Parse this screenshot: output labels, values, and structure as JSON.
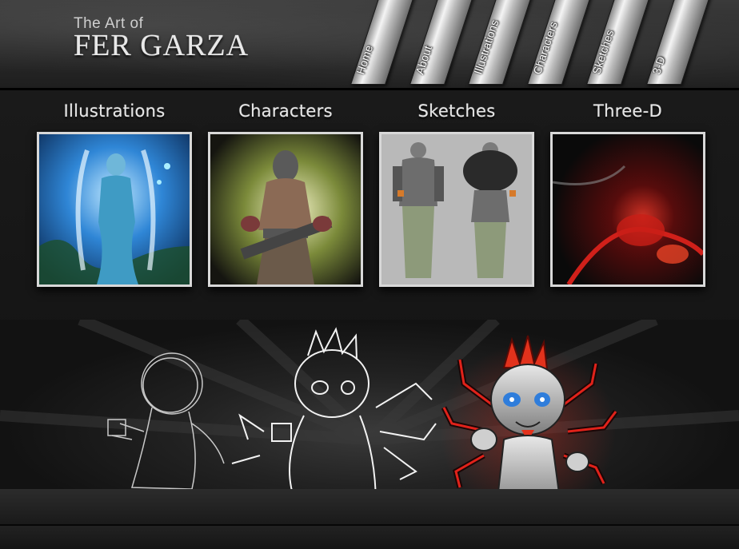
{
  "header": {
    "logo_sub": "The Art of",
    "logo_main": "FER GARZA"
  },
  "nav": {
    "items": [
      {
        "label": "Home"
      },
      {
        "label": "About"
      },
      {
        "label": "Illustrations"
      },
      {
        "label": "Characters"
      },
      {
        "label": "Sketches"
      },
      {
        "label": "3-D"
      }
    ]
  },
  "gallery": {
    "items": [
      {
        "title": "Illustrations"
      },
      {
        "title": "Characters"
      },
      {
        "title": "Sketches"
      },
      {
        "title": "Three-D"
      }
    ]
  },
  "colors": {
    "background": "#111111",
    "frame": "#d8d8d8",
    "accent_red": "#e0221a",
    "accent_blue": "#2f7ddb"
  }
}
